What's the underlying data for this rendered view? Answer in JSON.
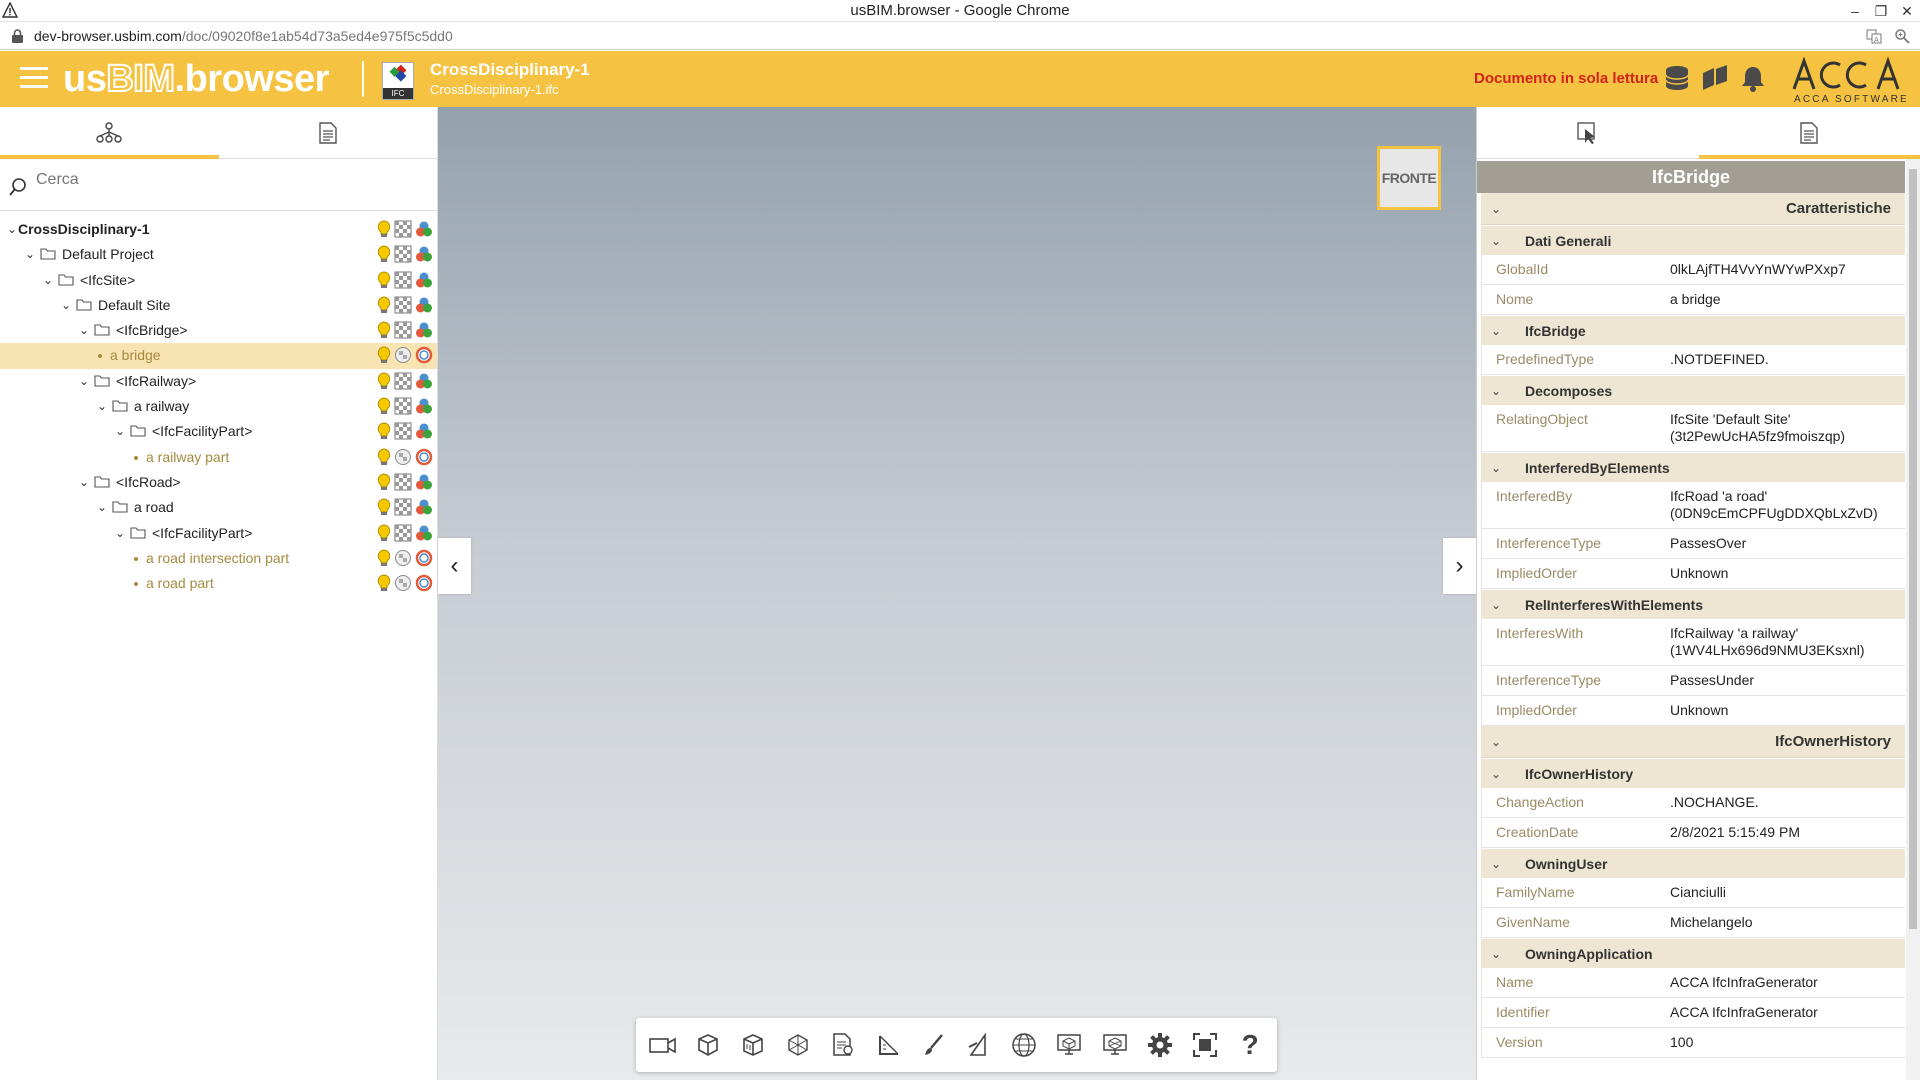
{
  "window": {
    "title": "usBIM.browser - Google Chrome",
    "controls": [
      "–",
      "❐",
      "✕"
    ]
  },
  "address": {
    "host": "dev-browser.usbim.com",
    "path": "/doc/09020f8e1ab54d73a5ed4e975f5c5dd0"
  },
  "app": {
    "logo_us": "us",
    "logo_bim": "BIM",
    "logo_browser": ".browser",
    "doc_title": "CrossDisciplinary-1",
    "doc_file": "CrossDisciplinary-1.ifc",
    "ifc_badge": "IFC",
    "readonly_text": "Documento in sola lettura",
    "brand_text": "ACCA SOFTWARE",
    "accent_color": "#f5c242",
    "readonly_color": "#d1231a"
  },
  "left": {
    "search_placeholder": "Cerca",
    "tree": [
      {
        "label": "CrossDisciplinary-1",
        "level": 0,
        "type": "root"
      },
      {
        "label": "Default Project",
        "level": 1,
        "type": "folder"
      },
      {
        "label": "<IfcSite>",
        "level": 2,
        "type": "folder"
      },
      {
        "label": "Default Site",
        "level": 3,
        "type": "folder"
      },
      {
        "label": "<IfcBridge>",
        "level": 4,
        "type": "folder"
      },
      {
        "label": "a bridge",
        "level": 5,
        "type": "leaf",
        "selected": true
      },
      {
        "label": "<IfcRailway>",
        "level": 4,
        "type": "folder"
      },
      {
        "label": "a railway",
        "level": 5,
        "type": "folder"
      },
      {
        "label": "<IfcFacilityPart>",
        "level": 6,
        "type": "folder"
      },
      {
        "label": "a railway part",
        "level": 7,
        "type": "leaf"
      },
      {
        "label": "<IfcRoad>",
        "level": 4,
        "type": "folder"
      },
      {
        "label": "a road",
        "level": 5,
        "type": "folder"
      },
      {
        "label": "<IfcFacilityPart>",
        "level": 6,
        "type": "folder"
      },
      {
        "label": "a road intersection part",
        "level": 7,
        "type": "leaf"
      },
      {
        "label": "a road part",
        "level": 7,
        "type": "leaf"
      }
    ]
  },
  "viewport": {
    "view_cube_label": "FRONTE"
  },
  "toolbar": {
    "tools": [
      "camera-icon",
      "cube-icon",
      "box-icon",
      "section-box-icon",
      "properties-icon",
      "measure-icon",
      "brush-icon",
      "plane-icon",
      "globe-icon",
      "model-view-icon",
      "model-view-2-icon",
      "settings-icon",
      "fit-view-icon",
      "help-icon"
    ],
    "help_glyph": "?"
  },
  "right": {
    "entity_title": "IfcBridge",
    "sections": [
      {
        "title": "Caratteristiche",
        "groups": [
          {
            "title": "Dati Generali",
            "props": [
              {
                "k": "GlobalId",
                "v": "0lkLAjfTH4VvYnWYwPXxp7"
              },
              {
                "k": "Nome",
                "v": "a bridge"
              }
            ]
          },
          {
            "title": "IfcBridge",
            "props": [
              {
                "k": "PredefinedType",
                "v": ".NOTDEFINED."
              }
            ]
          },
          {
            "title": "Decomposes",
            "props": [
              {
                "k": "RelatingObject",
                "v": "IfcSite 'Default Site' (3t2PewUcHA5fz9fmoiszqp)"
              }
            ]
          },
          {
            "title": "InterferedByElements",
            "props": [
              {
                "k": "InterferedBy",
                "v": "IfcRoad 'a road' (0DN9cEmCPFUgDDXQbLxZvD)"
              },
              {
                "k": "InterferenceType",
                "v": "PassesOver"
              },
              {
                "k": "ImpliedOrder",
                "v": "Unknown"
              }
            ]
          },
          {
            "title": "RelInterferesWithElements",
            "props": [
              {
                "k": "InterferesWith",
                "v": "IfcRailway 'a railway' (1WV4LHx696d9NMU3EKsxnl)"
              },
              {
                "k": "InterferenceType",
                "v": "PassesUnder"
              },
              {
                "k": "ImpliedOrder",
                "v": "Unknown"
              }
            ]
          }
        ]
      },
      {
        "title": "IfcOwnerHistory",
        "groups": [
          {
            "title": "IfcOwnerHistory",
            "props": [
              {
                "k": "ChangeAction",
                "v": ".NOCHANGE."
              },
              {
                "k": "CreationDate",
                "v": "2/8/2021 5:15:49 PM"
              }
            ]
          },
          {
            "title": "OwningUser",
            "props": [
              {
                "k": "FamilyName",
                "v": "Cianciulli"
              },
              {
                "k": "GivenName",
                "v": "Michelangelo"
              }
            ]
          },
          {
            "title": "OwningApplication",
            "props": [
              {
                "k": "Name",
                "v": "ACCA IfcInfraGenerator"
              },
              {
                "k": "Identifier",
                "v": "ACCA IfcInfraGenerator"
              },
              {
                "k": "Version",
                "v": "100"
              }
            ]
          }
        ]
      }
    ]
  }
}
